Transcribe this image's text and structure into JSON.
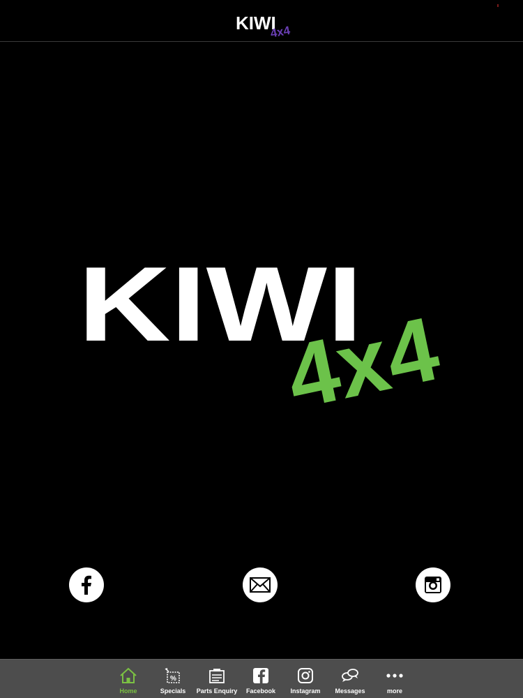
{
  "header": {
    "logo_text": "KIWI",
    "logo_sub": "4x4",
    "logo_sub_color": "#6a3fb5"
  },
  "hero": {
    "logo_text": "KIWI",
    "logo_sub": "4x4",
    "logo_sub_color": "#6cc24a"
  },
  "social": [
    {
      "icon": "facebook-icon"
    },
    {
      "icon": "mail-icon"
    },
    {
      "icon": "instagram-icon"
    }
  ],
  "tabbar": {
    "active_color": "#7bc143",
    "items": [
      {
        "label": "Home",
        "icon": "home-icon",
        "active": true
      },
      {
        "label": "Specials",
        "icon": "specials-icon"
      },
      {
        "label": "Parts Enquiry",
        "icon": "parts-enquiry-icon"
      },
      {
        "label": "Facebook",
        "icon": "facebook-icon"
      },
      {
        "label": "Instagram",
        "icon": "instagram-icon"
      },
      {
        "label": "Messages",
        "icon": "messages-icon"
      },
      {
        "label": "more",
        "icon": "more-icon"
      }
    ]
  }
}
